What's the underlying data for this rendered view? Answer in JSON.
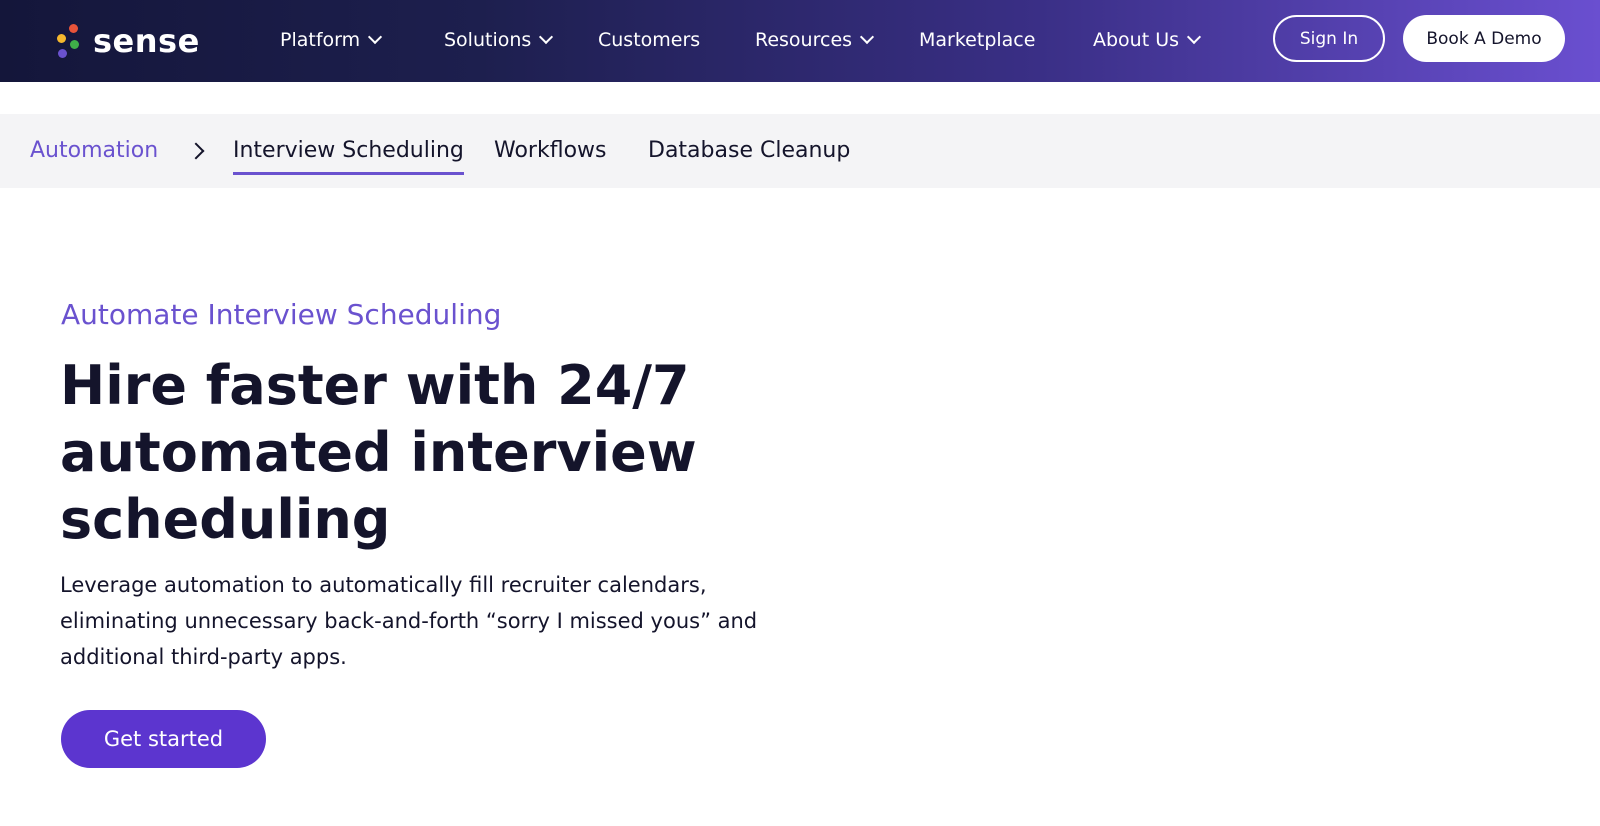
{
  "brand": {
    "name": "sense",
    "dot_colors": [
      "#e8543a",
      "#f5b82e",
      "#3fae49",
      "#6a52cf"
    ]
  },
  "nav": {
    "items": [
      {
        "label": "Platform",
        "has_dropdown": true
      },
      {
        "label": "Solutions",
        "has_dropdown": true
      },
      {
        "label": "Customers",
        "has_dropdown": false
      },
      {
        "label": "Resources",
        "has_dropdown": true
      },
      {
        "label": "Marketplace",
        "has_dropdown": false
      },
      {
        "label": "About Us",
        "has_dropdown": true
      }
    ],
    "sign_in_label": "Sign In",
    "book_demo_label": "Book A Demo"
  },
  "subnav": {
    "parent_label": "Automation",
    "items": [
      {
        "label": "Interview Scheduling",
        "active": true
      },
      {
        "label": "Workflows",
        "active": false
      },
      {
        "label": "Database Cleanup",
        "active": false
      }
    ]
  },
  "hero": {
    "eyebrow": "Automate Interview Scheduling",
    "headline": "Hire faster with 24/7 automated interview scheduling",
    "body": "Leverage automation to automatically fill recruiter calendars, eliminating unnecessary back-and-forth “sorry I missed yous” and additional third-party apps.",
    "cta_label": "Get started"
  },
  "colors": {
    "accent": "#6a52cf",
    "cta": "#5c35cf",
    "text_dark": "#14142b",
    "subnav_bg": "#f4f4f6"
  }
}
